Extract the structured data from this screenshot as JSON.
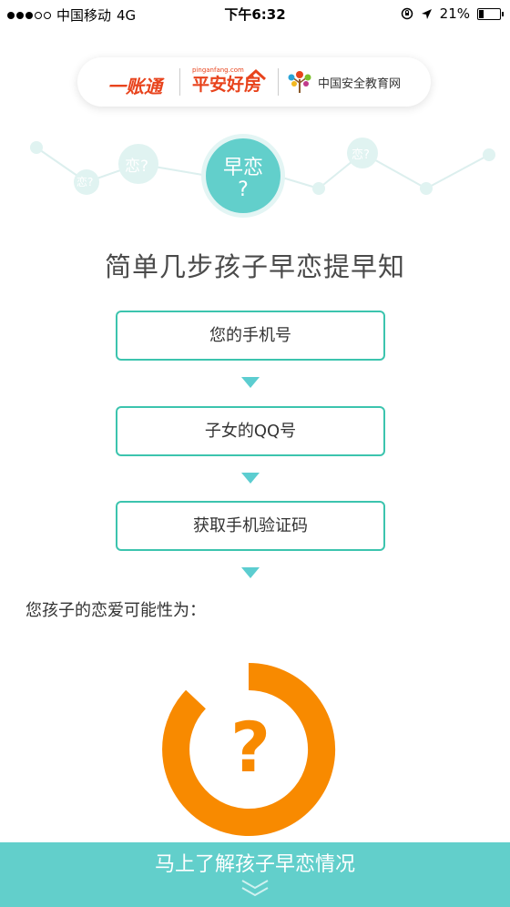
{
  "status_bar": {
    "carrier": "中国移动",
    "network": "4G",
    "time": "下午6:32",
    "battery": "21%"
  },
  "logos": {
    "yizhangtong": "一账通",
    "pingan_small": "pinganfang.com",
    "pingan_big": "平安好房",
    "edu": "中国安全教育网"
  },
  "hero": {
    "line1": "早恋",
    "line2": "?"
  },
  "decorations": {
    "bubble_left": "恋?",
    "bubble_small": "恋?",
    "bubble_right": "恋?"
  },
  "main_title": "简单几步孩子早恋提早知",
  "steps": {
    "phone_placeholder": "您的手机号",
    "qq_placeholder": "子女的QQ号",
    "get_code_button": "获取手机验证码"
  },
  "question": "您孩子的恋爱可能性为：",
  "result": {
    "symbol": "?",
    "color": "#f88a00"
  },
  "cta": {
    "label": "马上了解孩子早恋情况"
  },
  "colors": {
    "accent": "#62cfcb",
    "border": "#3cc4ae",
    "orange": "#f88a00",
    "brand_red": "#e8431c"
  }
}
